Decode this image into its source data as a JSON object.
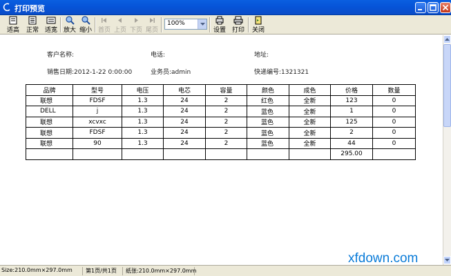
{
  "window": {
    "title": "打印预览"
  },
  "toolbar": {
    "items": [
      {
        "label": "适高",
        "icon": "fit-height-icon"
      },
      {
        "label": "正常",
        "icon": "normal-size-icon"
      },
      {
        "label": "适宽",
        "icon": "fit-width-icon"
      },
      {
        "label": "放大",
        "icon": "zoom-in-icon"
      },
      {
        "label": "缩小",
        "icon": "zoom-out-icon"
      },
      {
        "label": "首页",
        "icon": "first-page-icon"
      },
      {
        "label": "上页",
        "icon": "prev-page-icon"
      },
      {
        "label": "下页",
        "icon": "next-page-icon"
      },
      {
        "label": "尾页",
        "icon": "last-page-icon"
      },
      {
        "label": "设置",
        "icon": "settings-icon"
      },
      {
        "label": "打印",
        "icon": "printer-icon"
      },
      {
        "label": "关闭",
        "icon": "close-door-icon"
      }
    ],
    "zoom_value": "100%"
  },
  "document": {
    "customer_label": "客户名称:",
    "phone_label": "电话:",
    "address_label": "地址:",
    "sale_date": "销售日期:2012-1-22 0:00:00",
    "salesperson": "业务员:admin",
    "tracking_no": "快递编号:1321321",
    "table": {
      "headers": [
        "品牌",
        "型号",
        "电压",
        "电芯",
        "容量",
        "颜色",
        "成色",
        "价格",
        "数量"
      ],
      "rows": [
        [
          "联想",
          "FDSF",
          "1.3",
          "24",
          "2",
          "红色",
          "全新",
          "123",
          "0"
        ],
        [
          "DELL",
          "j",
          "1.3",
          "24",
          "2",
          "蓝色",
          "全新",
          "1",
          "0"
        ],
        [
          "联想",
          "xcvxc",
          "1.3",
          "24",
          "2",
          "蓝色",
          "全新",
          "125",
          "0"
        ],
        [
          "联想",
          "FDSF",
          "1.3",
          "24",
          "2",
          "蓝色",
          "全新",
          "2",
          "0"
        ],
        [
          "联想",
          "90",
          "1.3",
          "24",
          "2",
          "蓝色",
          "全新",
          "44",
          "0"
        ]
      ],
      "total": "295.00"
    }
  },
  "status": {
    "size": "Size:210.0mm×297.0mm",
    "page": "第1页/共1页",
    "paper": "纸张:210.0mm×297.0mm"
  },
  "watermark": "xfdown.com"
}
